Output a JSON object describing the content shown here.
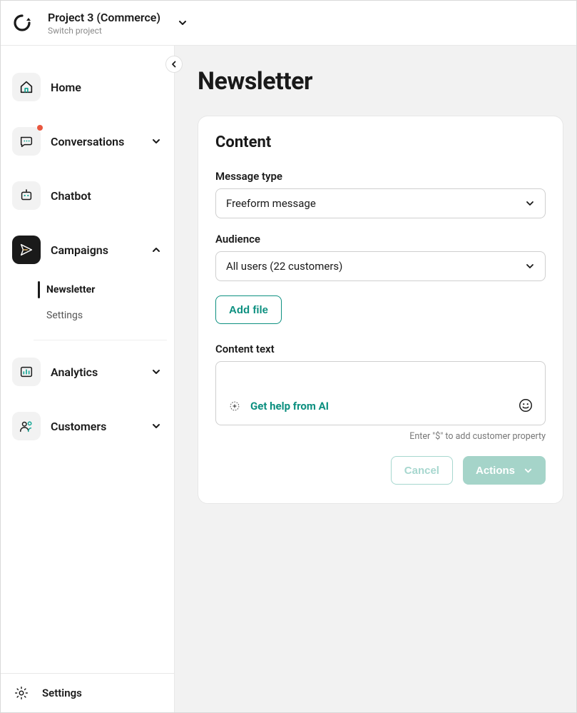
{
  "header": {
    "project_title": "Project 3 (Commerce)",
    "switch_label": "Switch project"
  },
  "sidebar": {
    "items": [
      {
        "label": "Home",
        "expandable": false
      },
      {
        "label": "Conversations",
        "expandable": true,
        "has_badge": true
      },
      {
        "label": "Chatbot",
        "expandable": false
      },
      {
        "label": "Campaigns",
        "expandable": true,
        "active": true
      },
      {
        "label": "Analytics",
        "expandable": true
      },
      {
        "label": "Customers",
        "expandable": true
      }
    ],
    "campaigns_sub": [
      {
        "label": "Newsletter",
        "active": true
      },
      {
        "label": "Settings",
        "active": false
      }
    ],
    "footer": {
      "label": "Settings"
    }
  },
  "page": {
    "title": "Newsletter",
    "content_section": {
      "title": "Content",
      "message_type": {
        "label": "Message type",
        "value": "Freeform message"
      },
      "audience": {
        "label": "Audience",
        "value": "All users (22 customers)"
      },
      "add_file_label": "Add file",
      "content_text_label": "Content text",
      "ai_help_label": "Get help from AI",
      "hint": "Enter \"$\" to add customer property",
      "cancel_label": "Cancel",
      "actions_label": "Actions"
    }
  }
}
